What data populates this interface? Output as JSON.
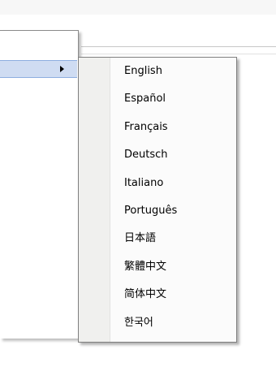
{
  "parent_menu": {
    "highlight_color": "#cfdcf2",
    "arrow_icon": "chevron-right-icon"
  },
  "language_menu": {
    "items": [
      {
        "label": "English"
      },
      {
        "label": "Español"
      },
      {
        "label": "Français"
      },
      {
        "label": "Deutsch"
      },
      {
        "label": "Italiano"
      },
      {
        "label": "Português"
      },
      {
        "label": "日本語"
      },
      {
        "label": "繁體中文"
      },
      {
        "label": "简体中文"
      },
      {
        "label": "한국어"
      }
    ]
  }
}
